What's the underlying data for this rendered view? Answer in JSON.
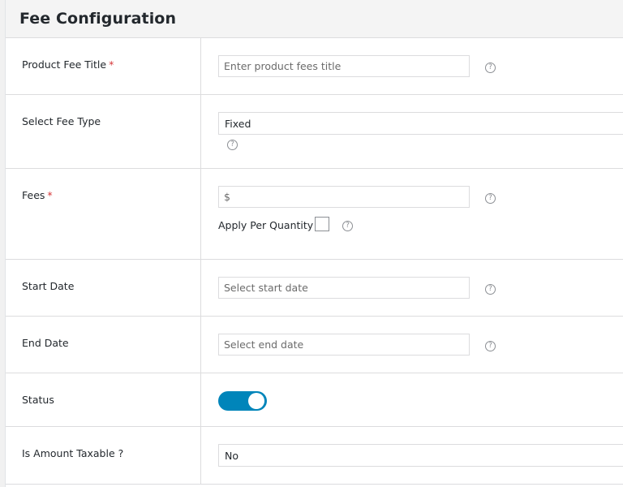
{
  "header": {
    "title": "Fee Configuration"
  },
  "colors": {
    "accent": "#0085ba",
    "required": "#d63638",
    "border": "#dcdcde"
  },
  "fields": {
    "product_fee_title": {
      "label": "Product Fee Title",
      "required_mark": "*",
      "value": "",
      "placeholder": "Enter product fees title",
      "help_icon": "question-circle-icon"
    },
    "fee_type": {
      "label": "Select Fee Type",
      "selected": "Fixed",
      "help_icon": "question-circle-icon"
    },
    "fees": {
      "label": "Fees",
      "required_mark": "*",
      "value": "",
      "placeholder": "$",
      "help_icon": "question-circle-icon",
      "apply_per_quantity": {
        "label": "Apply Per Quantity",
        "checked": false
      }
    },
    "start_date": {
      "label": "Start Date",
      "value": "",
      "placeholder": "Select start date",
      "help_icon": "question-circle-icon"
    },
    "end_date": {
      "label": "End Date",
      "value": "",
      "placeholder": "Select end date",
      "help_icon": "question-circle-icon"
    },
    "status": {
      "label": "Status",
      "enabled": true
    },
    "taxable": {
      "label": "Is Amount Taxable ?",
      "selected": "No"
    }
  },
  "help_glyph": "?"
}
